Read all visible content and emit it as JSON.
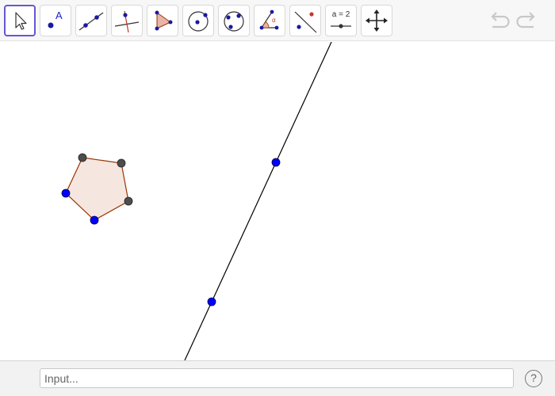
{
  "toolbar": {
    "tools": [
      {
        "name": "move-tool",
        "icon": "cursor-arrow-icon",
        "active": true
      },
      {
        "name": "point-tool",
        "icon": "point-with-label-icon",
        "label": "A"
      },
      {
        "name": "line-tool",
        "icon": "line-through-two-points-icon"
      },
      {
        "name": "perpendicular-line-tool",
        "icon": "perpendicular-line-icon"
      },
      {
        "name": "polygon-tool",
        "icon": "polygon-icon"
      },
      {
        "name": "circle-center-point-tool",
        "icon": "circle-with-center-icon"
      },
      {
        "name": "circle-three-points-tool",
        "icon": "circle-through-three-points-icon"
      },
      {
        "name": "angle-tool",
        "icon": "angle-icon",
        "label": "α"
      },
      {
        "name": "reflect-tool",
        "icon": "reflect-about-line-icon"
      },
      {
        "name": "slider-tool",
        "icon": "slider-icon",
        "label": "a = 2"
      },
      {
        "name": "move-graphics-view-tool",
        "icon": "move-cross-arrows-icon"
      }
    ],
    "undo_icon": "undo-icon",
    "redo_icon": "redo-icon",
    "undo_enabled": false,
    "redo_enabled": false
  },
  "colors": {
    "active_tool_border": "#6557d2",
    "free_point": "#0000ff",
    "dependent_point": "#4d4d4d",
    "polygon_fill": "#f6e6e0",
    "polygon_edge": "#993300",
    "line": "#000000"
  },
  "input_bar": {
    "placeholder": "Input...",
    "value": "",
    "help_label": "?"
  }
}
